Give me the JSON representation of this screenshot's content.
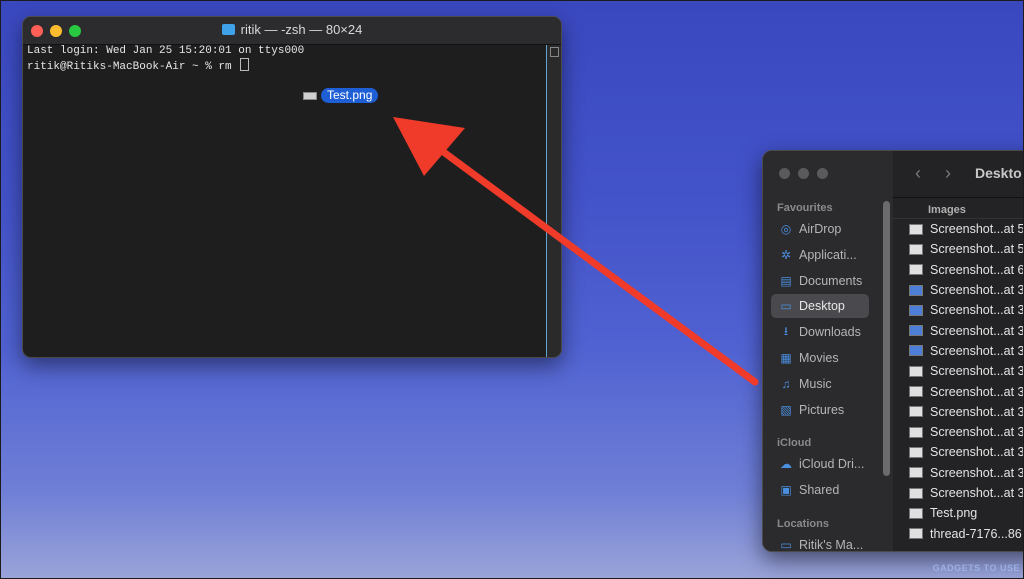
{
  "terminal": {
    "title": "ritik — -zsh — 80×24",
    "lines": [
      "Last login: Wed Jan 25 15:20:01 on ttys000",
      "ritik@Ritiks-MacBook-Air ~ % rm "
    ],
    "drag_label": "Test.png"
  },
  "finder": {
    "title": "Deskto",
    "column_header": "Images",
    "sidebar": {
      "favourites_label": "Favourites",
      "favourites": [
        {
          "label": "AirDrop",
          "icon": "airdrop-icon"
        },
        {
          "label": "Applicati...",
          "icon": "applications-icon"
        },
        {
          "label": "Documents",
          "icon": "document-icon"
        },
        {
          "label": "Desktop",
          "icon": "desktop-icon",
          "selected": true
        },
        {
          "label": "Downloads",
          "icon": "download-icon"
        },
        {
          "label": "Movies",
          "icon": "film-icon"
        },
        {
          "label": "Music",
          "icon": "music-icon"
        },
        {
          "label": "Pictures",
          "icon": "picture-icon"
        }
      ],
      "icloud_label": "iCloud",
      "icloud": [
        {
          "label": "iCloud Dri...",
          "icon": "cloud-icon"
        },
        {
          "label": "Shared",
          "icon": "shared-folder-icon"
        }
      ],
      "locations_label": "Locations",
      "locations": [
        {
          "label": "Ritik's Ma...",
          "icon": "laptop-icon"
        }
      ]
    },
    "files": [
      {
        "name": "Screenshot...at 5",
        "thumb": "light"
      },
      {
        "name": "Screenshot...at 5",
        "thumb": "light"
      },
      {
        "name": "Screenshot...at 6",
        "thumb": "light"
      },
      {
        "name": "Screenshot...at 3",
        "thumb": "blue"
      },
      {
        "name": "Screenshot...at 3",
        "thumb": "blue"
      },
      {
        "name": "Screenshot...at 3",
        "thumb": "blue"
      },
      {
        "name": "Screenshot...at 3",
        "thumb": "blue"
      },
      {
        "name": "Screenshot...at 3",
        "thumb": "light"
      },
      {
        "name": "Screenshot...at 3",
        "thumb": "light"
      },
      {
        "name": "Screenshot...at 3",
        "thumb": "light"
      },
      {
        "name": "Screenshot...at 3",
        "thumb": "light"
      },
      {
        "name": "Screenshot...at 3",
        "thumb": "light"
      },
      {
        "name": "Screenshot...at 3",
        "thumb": "light"
      },
      {
        "name": "Screenshot...at 3",
        "thumb": "light"
      },
      {
        "name": "Test.png",
        "thumb": "light"
      },
      {
        "name": "thread-7176...86",
        "thumb": "light"
      }
    ]
  },
  "watermark": "GADGETS TO USE",
  "colors": {
    "arrow": "#f03a2a",
    "drag_highlight": "#1f5fd6",
    "sidebar_accent": "#4a8fe0"
  }
}
